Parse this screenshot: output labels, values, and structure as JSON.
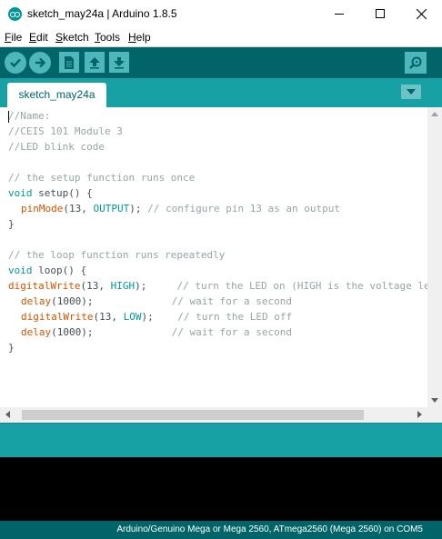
{
  "window": {
    "title": "sketch_may24a | Arduino 1.8.5",
    "controls": [
      "minimize-icon",
      "maximize-icon",
      "close-icon"
    ]
  },
  "menu": {
    "items": [
      "File",
      "Edit",
      "Sketch",
      "Tools",
      "Help"
    ]
  },
  "toolbar": {
    "buttons": [
      "verify-icon",
      "upload-icon",
      "new-icon",
      "open-icon",
      "save-icon"
    ],
    "right_button": "serial-monitor-icon"
  },
  "tabs": {
    "active": "sketch_may24a"
  },
  "editor": {
    "lines": {
      "l1": "//Name:",
      "l2": "//CEIS 101 Module 3",
      "l3": "//LED blink code",
      "l5": "// the setup function runs once",
      "l6a": "void",
      "l6b": " setup() {",
      "l7a": "pinMode",
      "l7b": "(13, ",
      "l7c": "OUTPUT",
      "l7d": "); ",
      "l7e": "// configure pin 13 as an output",
      "l8": "}",
      "l10": "// the loop function runs repeatedly",
      "l11a": "void",
      "l11b": " loop() {",
      "l12a": "digitalWrite",
      "l12b": "(13, ",
      "l12c": "HIGH",
      "l12d": ");     ",
      "l12e": "// turn the LED on (HIGH is the voltage level)",
      "l13a": "delay",
      "l13b": "(1000);             ",
      "l13c": "// wait for a second",
      "l14a": "digitalWrite",
      "l14b": "(13, ",
      "l14c": "LOW",
      "l14d": ");    ",
      "l14e": "// turn the LED off",
      "l15a": "delay",
      "l15b": "(1000);             ",
      "l15c": "// wait for a second",
      "l16": "}"
    }
  },
  "status": {
    "board": "Arduino/Genuino Mega or Mega 2560, ATmega2560 (Mega 2560) on COM5"
  },
  "colors": {
    "toolbar": "#006468",
    "tab_bar": "#17a1a5",
    "button": "#4db7bb",
    "console": "#000000",
    "keyword": "#00979c",
    "function": "#d35400",
    "comment": "#95a5a6"
  }
}
